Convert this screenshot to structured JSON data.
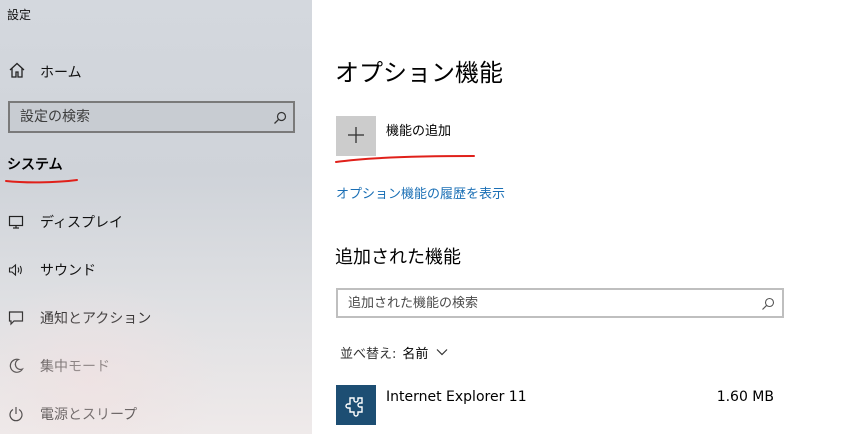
{
  "window": {
    "title": "設定"
  },
  "sidebar": {
    "home_label": "ホーム",
    "search_placeholder": "設定の検索",
    "section_title": "システム",
    "items": [
      {
        "label": "ディスプレイ",
        "icon": "monitor-icon"
      },
      {
        "label": "サウンド",
        "icon": "speaker-icon"
      },
      {
        "label": "通知とアクション",
        "icon": "notification-icon"
      },
      {
        "label": "集中モード",
        "icon": "moon-icon"
      },
      {
        "label": "電源とスリープ",
        "icon": "power-icon"
      }
    ]
  },
  "main": {
    "title": "オプション機能",
    "add_feature_label": "機能の追加",
    "history_link": "オプション機能の履歴を表示",
    "installed_heading": "追加された機能",
    "installed_search_placeholder": "追加された機能の検索",
    "sort_label": "並べ替え:",
    "sort_value": "名前",
    "features": [
      {
        "name": "Internet Explorer 11",
        "size": "1.60 MB",
        "icon": "puzzle-icon"
      }
    ]
  },
  "colors": {
    "accent_link": "#1a6fb5",
    "feature_icon_bg": "#1d4e73",
    "annotation": "#e0201a"
  }
}
